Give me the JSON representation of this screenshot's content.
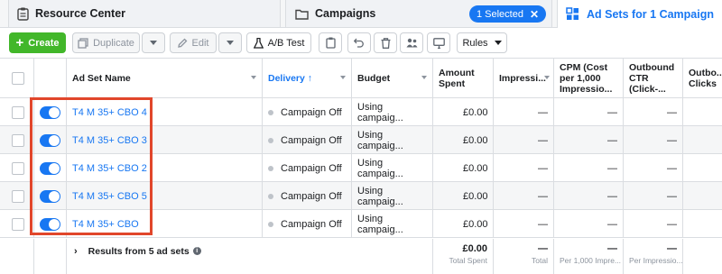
{
  "tabs": {
    "resource_center": "Resource Center",
    "campaigns": "Campaigns",
    "selected_badge": "1 Selected",
    "adsets": "Ad Sets for 1 Campaign"
  },
  "toolbar": {
    "create": "Create",
    "duplicate": "Duplicate",
    "edit": "Edit",
    "ab_test": "A/B Test",
    "rules": "Rules"
  },
  "table": {
    "headers": {
      "name": "Ad Set Name",
      "delivery": "Delivery ↑",
      "budget": "Budget",
      "amount_spent": "Amount Spent",
      "impressions": "Impressi...",
      "cpm": "CPM (Cost per 1,000 Impressio...",
      "outbound_ctr": "Outbound CTR (Click-...",
      "outbound_clicks": "Outbo... Clicks"
    },
    "rows": [
      {
        "name": "T4 M 35+ CBO 4",
        "delivery": "Campaign Off",
        "budget": "Using campaig...",
        "spent": "£0.00",
        "impressions": "—",
        "cpm": "—",
        "ctr": "—"
      },
      {
        "name": "T4 M 35+ CBO 3",
        "delivery": "Campaign Off",
        "budget": "Using campaig...",
        "spent": "£0.00",
        "impressions": "—",
        "cpm": "—",
        "ctr": "—"
      },
      {
        "name": "T4 M 35+ CBO 2",
        "delivery": "Campaign Off",
        "budget": "Using campaig...",
        "spent": "£0.00",
        "impressions": "—",
        "cpm": "—",
        "ctr": "—"
      },
      {
        "name": "T4 M 35+ CBO 5",
        "delivery": "Campaign Off",
        "budget": "Using campaig...",
        "spent": "£0.00",
        "impressions": "—",
        "cpm": "—",
        "ctr": "—"
      },
      {
        "name": "T4 M 35+ CBO",
        "delivery": "Campaign Off",
        "budget": "Using campaig...",
        "spent": "£0.00",
        "impressions": "—",
        "cpm": "—",
        "ctr": "—"
      }
    ],
    "footer": {
      "results": "Results from 5 ad sets",
      "spent": "£0.00",
      "spent_sub": "Total Spent",
      "impressions": "—",
      "impressions_sub": "Total",
      "cpm": "—",
      "cpm_sub": "Per 1,000 Impre...",
      "ctr": "—",
      "ctr_sub": "Per Impressio..."
    }
  },
  "colors": {
    "accent": "#1877f2",
    "create": "#42b72a",
    "highlight": "#e1462b"
  }
}
